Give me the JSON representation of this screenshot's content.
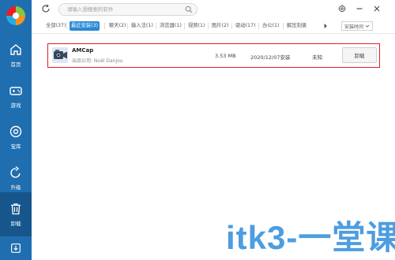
{
  "search": {
    "placeholder": "请输入想搜索的软件"
  },
  "sidebar": {
    "items": [
      {
        "label": "首页",
        "icon": "home-icon"
      },
      {
        "label": "游戏",
        "icon": "gamepad-icon"
      },
      {
        "label": "宝库",
        "icon": "treasure-icon"
      },
      {
        "label": "升级",
        "icon": "upgrade-icon"
      },
      {
        "label": "卸载",
        "icon": "trash-icon",
        "active": true
      }
    ],
    "bottom_icon": "download-icon"
  },
  "tabs": [
    {
      "label": "全部(37)"
    },
    {
      "label": "最近安装(3)",
      "active": true
    },
    {
      "label": "聊天(2)"
    },
    {
      "label": "输入法(1)"
    },
    {
      "label": "浏览器(1)"
    },
    {
      "label": "视频(1)"
    },
    {
      "label": "图片(2)"
    },
    {
      "label": "驱动(17)"
    },
    {
      "label": "办公(1)"
    },
    {
      "label": "解压刻录"
    }
  ],
  "sort": {
    "value": "安装时间"
  },
  "apps": [
    {
      "name": "AMCap",
      "publisher": "出品公司: Noël Danjou",
      "size": "3.53 MB",
      "install_date": "2020/12/07安装",
      "usage": "未知",
      "action": "卸载"
    }
  ],
  "watermark": {
    "text": "itk3-一堂课"
  },
  "colors": {
    "sidebar": "#1f6eb0",
    "sidebar_active": "#16568c",
    "accent": "#2a8ad8",
    "highlight_border": "#e02020",
    "watermark": "#4d9de0"
  }
}
